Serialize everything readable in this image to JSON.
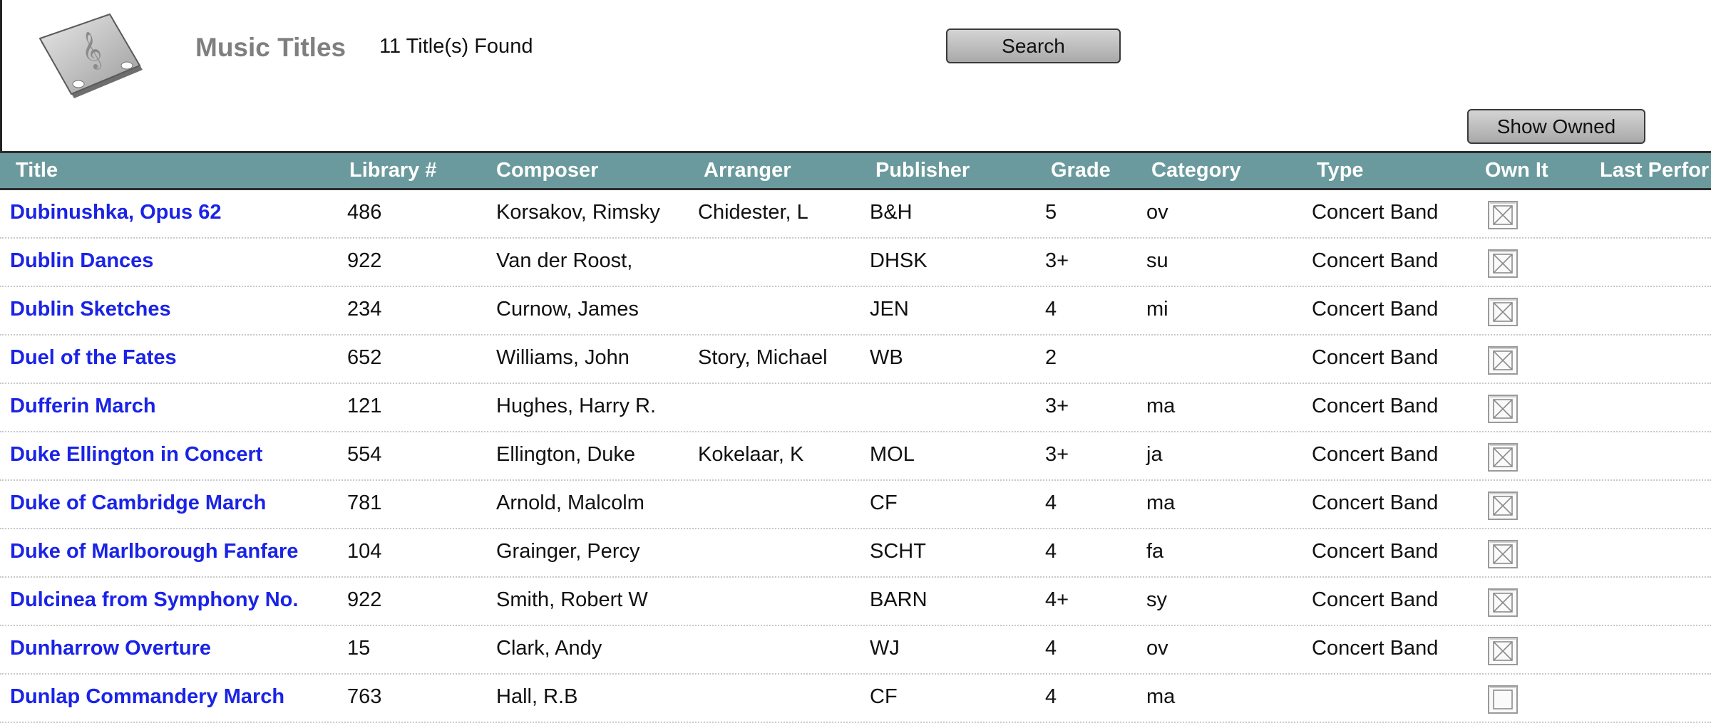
{
  "header": {
    "title": "Music Titles",
    "found_count": "11 Title(s) Found",
    "search_label": "Search",
    "show_owned_label": "Show Owned"
  },
  "table": {
    "columns": [
      "Title",
      "Library #",
      "Composer",
      "Arranger",
      "Publisher",
      "Grade",
      "Category",
      "Type",
      "Own It",
      "Last Perfor"
    ],
    "rows": [
      {
        "title": "Dubinushka, Opus 62",
        "library": "486",
        "composer": "Korsakov, Rimsky",
        "arranger": "Chidester, L",
        "publisher": "B&H",
        "grade": "5",
        "category": "ov",
        "type": "Concert Band",
        "own": true
      },
      {
        "title": "Dublin Dances",
        "library": "922",
        "composer": "Van der Roost,",
        "arranger": "",
        "publisher": "DHSK",
        "grade": "3+",
        "category": "su",
        "type": "Concert Band",
        "own": true
      },
      {
        "title": "Dublin Sketches",
        "library": "234",
        "composer": "Curnow, James",
        "arranger": "",
        "publisher": "JEN",
        "grade": "4",
        "category": "mi",
        "type": "Concert Band",
        "own": true
      },
      {
        "title": "Duel of the Fates",
        "library": "652",
        "composer": "Williams, John",
        "arranger": "Story, Michael",
        "publisher": "WB",
        "grade": "2",
        "category": "",
        "type": "Concert Band",
        "own": true
      },
      {
        "title": "Dufferin March",
        "library": "121",
        "composer": "Hughes, Harry R.",
        "arranger": "",
        "publisher": "",
        "grade": "3+",
        "category": "ma",
        "type": "Concert Band",
        "own": true
      },
      {
        "title": "Duke Ellington in Concert",
        "library": "554",
        "composer": "Ellington, Duke",
        "arranger": "Kokelaar, K",
        "publisher": "MOL",
        "grade": "3+",
        "category": "ja",
        "type": "Concert Band",
        "own": true
      },
      {
        "title": "Duke of Cambridge March",
        "library": "781",
        "composer": "Arnold, Malcolm",
        "arranger": "",
        "publisher": "CF",
        "grade": "4",
        "category": "ma",
        "type": "Concert Band",
        "own": true
      },
      {
        "title": "Duke of Marlborough Fanfare",
        "library": "104",
        "composer": "Grainger, Percy",
        "arranger": "",
        "publisher": "SCHT",
        "grade": "4",
        "category": "fa",
        "type": "Concert Band",
        "own": true
      },
      {
        "title": "Dulcinea from Symphony No.",
        "library": "922",
        "composer": "Smith, Robert W",
        "arranger": "",
        "publisher": "BARN",
        "grade": "4+",
        "category": "sy",
        "type": "Concert Band",
        "own": true
      },
      {
        "title": "Dunharrow Overture",
        "library": "15",
        "composer": "Clark, Andy",
        "arranger": "",
        "publisher": "WJ",
        "grade": "4",
        "category": "ov",
        "type": "Concert Band",
        "own": true
      },
      {
        "title": "Dunlap Commandery March",
        "library": "763",
        "composer": "Hall, R.B",
        "arranger": "",
        "publisher": "CF",
        "grade": "4",
        "category": "ma",
        "type": "",
        "own": false
      }
    ]
  },
  "colors": {
    "header_bg": "#6a9a9d",
    "link": "#1a23e6",
    "title_gray": "#7f7f7f"
  }
}
